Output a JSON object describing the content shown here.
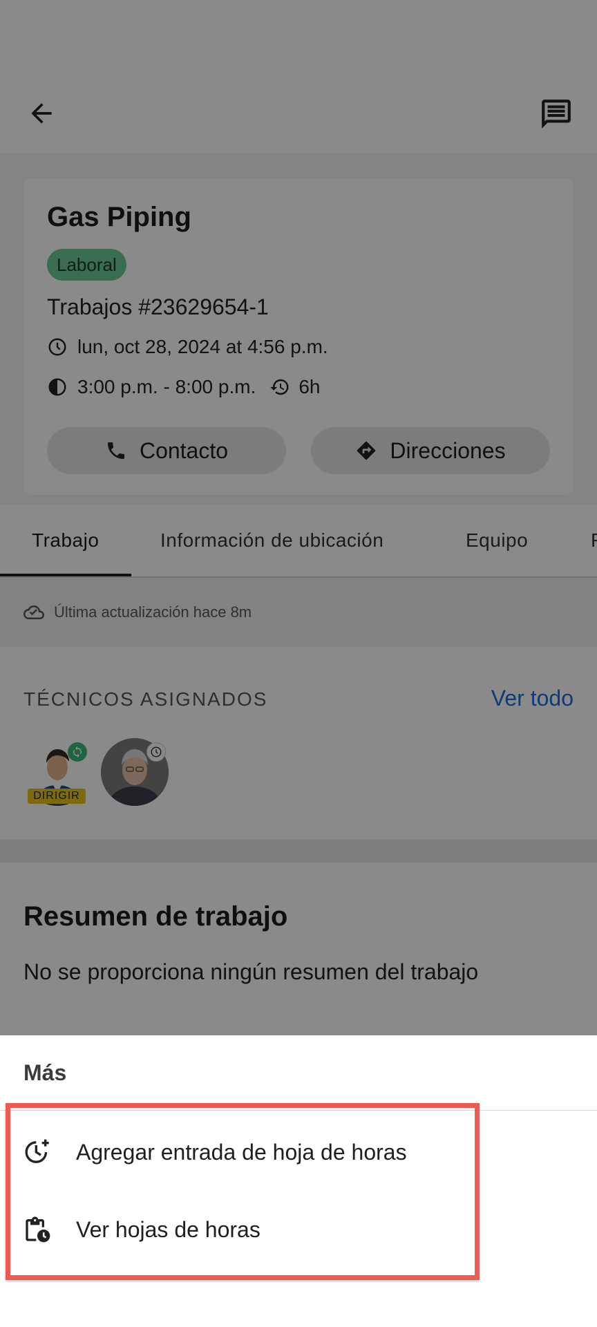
{
  "job": {
    "title": "Gas Piping",
    "badge": "Laboral",
    "number": "Trabajos #23629654-1",
    "datetime": "lun, oct 28, 2024 at 4:56 p.m.",
    "time_range": "3:00 p.m. - 8:00 p.m.",
    "duration": "6h",
    "contact_label": "Contacto",
    "directions_label": "Direcciones"
  },
  "tabs": [
    {
      "label": "Trabajo",
      "active": true
    },
    {
      "label": "Información de ubicación",
      "active": false
    },
    {
      "label": "Equipo",
      "active": false
    },
    {
      "label": "F",
      "active": false
    }
  ],
  "last_update": "Última actualización hace 8m",
  "technicians": {
    "label": "TÉCNICOS ASIGNADOS",
    "view_all": "Ver todo",
    "lead_badge": "DIRIGIR"
  },
  "summary": {
    "title": "Resumen de trabajo",
    "text": "No se proporciona ningún resumen del trabajo"
  },
  "sheet": {
    "title": "Más",
    "items": [
      {
        "label": "Agregar entrada de hoja de horas",
        "icon": "clock-plus-icon"
      },
      {
        "label": "Ver hojas de horas",
        "icon": "clipboard-clock-icon"
      }
    ]
  },
  "colors": {
    "badge": "#6cc79a",
    "link": "#1f6ed6",
    "highlight": "#ee5a52",
    "lead_badge": "#e8c51c"
  }
}
